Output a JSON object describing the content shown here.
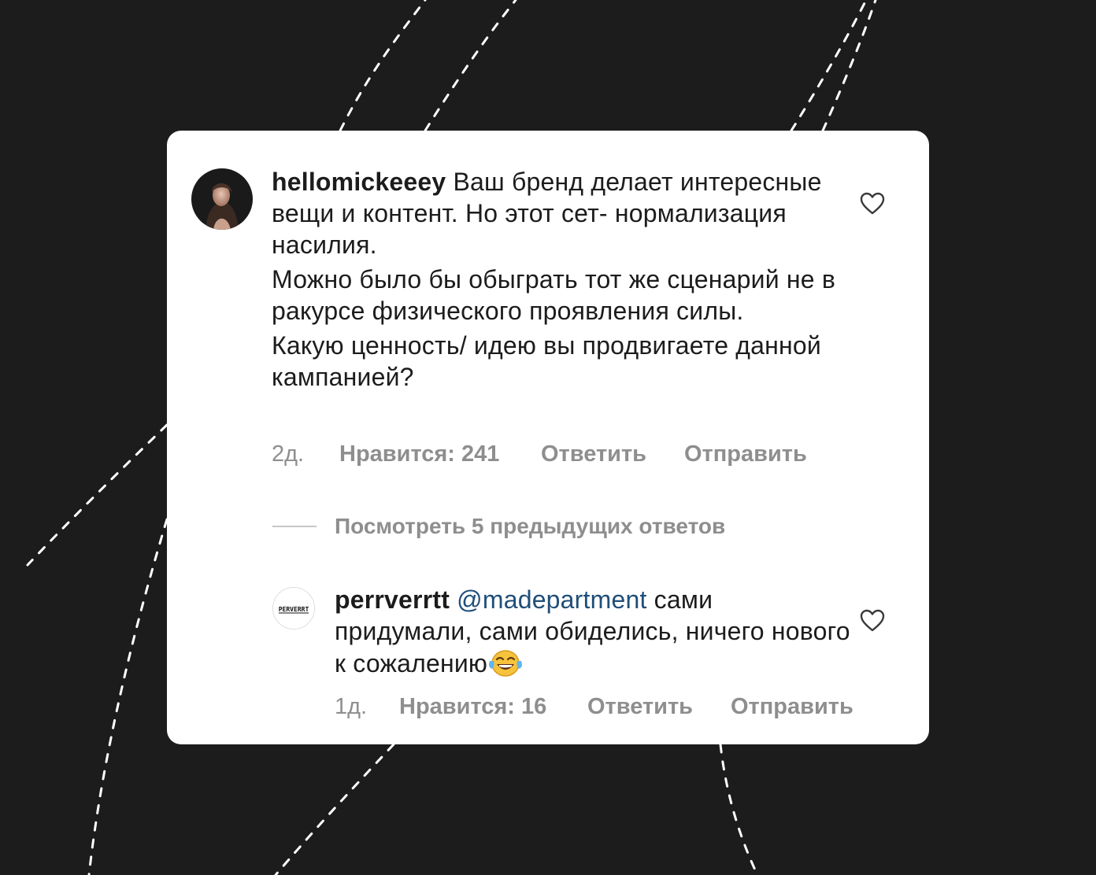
{
  "comments": [
    {
      "username": "hellomickeeey",
      "paragraphs": [
        "Ваш бренд делает интересные вещи и контент. Но этот сет- нормализация насилия.",
        "Можно было бы обыграть тот же сценарий не в ракурсе физического проявления силы.",
        "Какую ценность/ идею вы продвигаете данной кампанией?"
      ],
      "age": "2д.",
      "likes": "Нравится: 241",
      "reply": "Ответить",
      "send": "Отправить",
      "avatar_icon": "profile-photo"
    },
    {
      "username": "perrverrtt",
      "mention": "@madepartment",
      "text": " сами придумали, сами обиделись, ничего нового к сожалению",
      "emoji_icon": "face-with-tears-of-joy",
      "age": "1д.",
      "likes": "Нравится: 16",
      "reply": "Ответить",
      "send": "Отправить",
      "avatar_icon": "perverrt-logo",
      "avatar_logo_text": "PERVERRT"
    }
  ],
  "view_replies": "Посмотреть 5 предыдущих ответов",
  "icons": {
    "like": "heart-outline-icon"
  },
  "colors": {
    "background": "#1c1c1c",
    "card": "#ffffff",
    "text": "#1c1c1c",
    "muted": "#8e8e8e",
    "mention": "#1f4e79"
  }
}
